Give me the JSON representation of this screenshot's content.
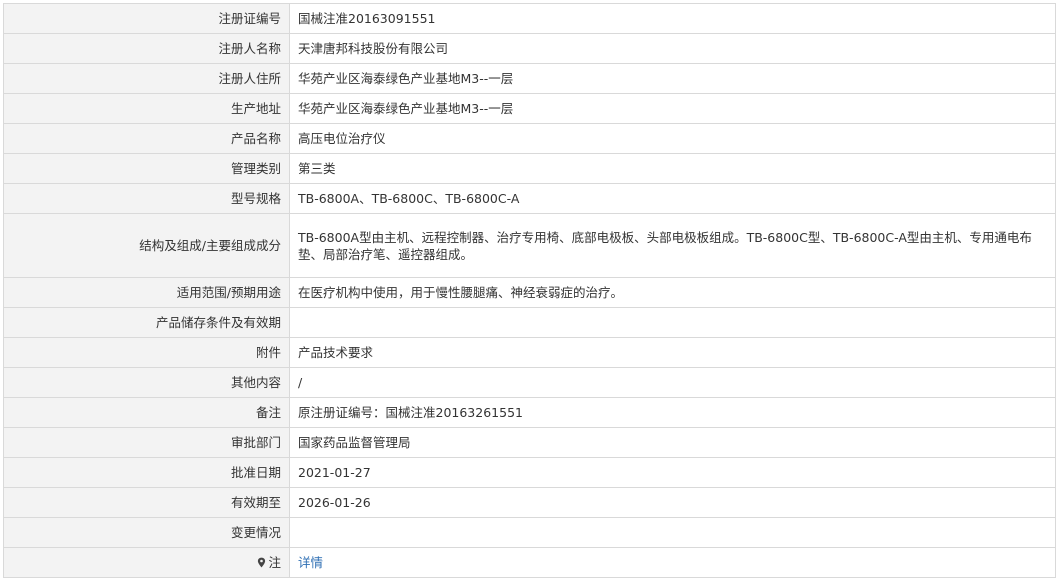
{
  "rows": [
    {
      "label": "注册证编号",
      "value": "国械注准20163091551"
    },
    {
      "label": "注册人名称",
      "value": "天津唐邦科技股份有限公司"
    },
    {
      "label": "注册人住所",
      "value": "华苑产业区海泰绿色产业基地M3--一层"
    },
    {
      "label": "生产地址",
      "value": "华苑产业区海泰绿色产业基地M3--一层"
    },
    {
      "label": "产品名称",
      "value": "高压电位治疗仪"
    },
    {
      "label": "管理类别",
      "value": "第三类"
    },
    {
      "label": "型号规格",
      "value": "TB-6800A、TB-6800C、TB-6800C-A"
    },
    {
      "label": "结构及组成/主要组成成分",
      "value": "TB-6800A型由主机、远程控制器、治疗专用椅、底部电极板、头部电极板组成。TB-6800C型、TB-6800C-A型由主机、专用通电布垫、局部治疗笔、遥控器组成。"
    },
    {
      "label": "适用范围/预期用途",
      "value": "在医疗机构中使用，用于慢性腰腿痛、神经衰弱症的治疗。"
    },
    {
      "label": "产品储存条件及有效期",
      "value": ""
    },
    {
      "label": "附件",
      "value": "产品技术要求"
    },
    {
      "label": "其他内容",
      "value": "/"
    },
    {
      "label": "备注",
      "value": "原注册证编号：国械注准20163261551"
    },
    {
      "label": "审批部门",
      "value": "国家药品监督管理局"
    },
    {
      "label": "批准日期",
      "value": "2021-01-27"
    },
    {
      "label": "有效期至",
      "value": "2026-01-26"
    },
    {
      "label": "变更情况",
      "value": ""
    }
  ],
  "note_row": {
    "label": "注",
    "icon": "map-pin-icon",
    "link_text": "详情",
    "link_color": "#2f6fb4"
  }
}
